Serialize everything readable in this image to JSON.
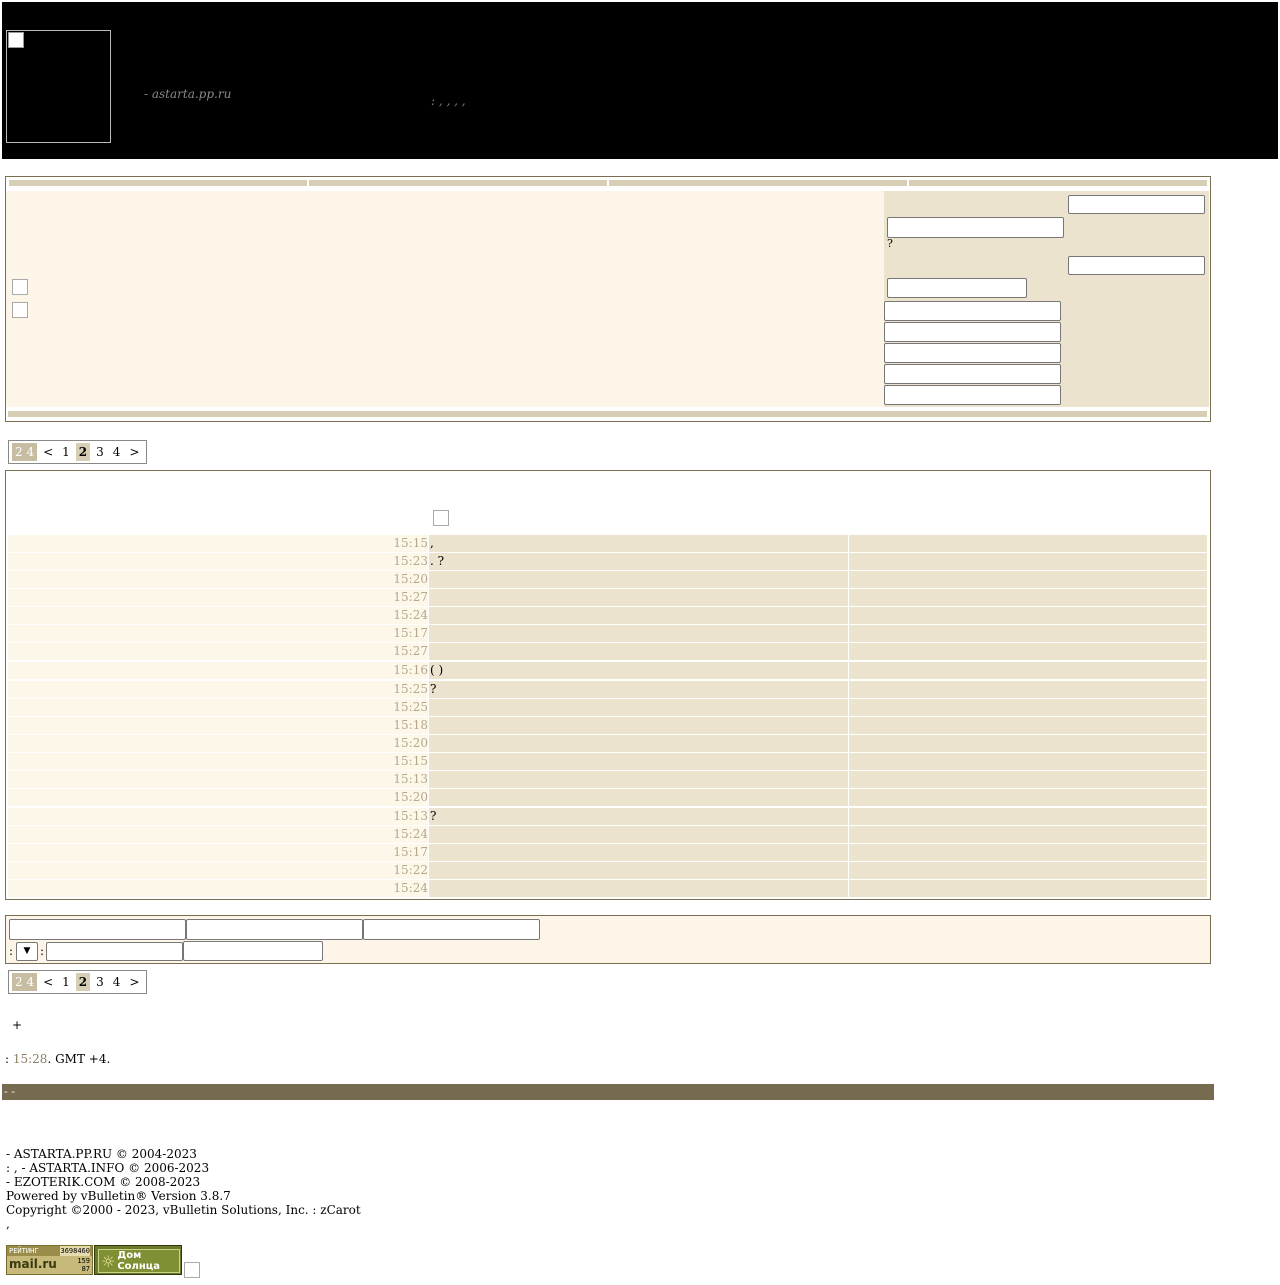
{
  "header": {
    "site_subtitle": "- astarta.pp.ru",
    "site_tags": ": , , , ,"
  },
  "pagination": {
    "info": "2 4",
    "prev": "<",
    "pages": [
      "1",
      "2",
      "3",
      "4"
    ],
    "current": "2",
    "next": ">"
  },
  "threads": [
    {
      "time": "15:15",
      "title": ","
    },
    {
      "time": "15:23",
      "title": ". ?"
    },
    {
      "time": "15:20",
      "title": ""
    },
    {
      "time": "15:27",
      "title": ""
    },
    {
      "time": "15:24",
      "title": ""
    },
    {
      "time": "15:17",
      "title": ""
    },
    {
      "time": "15:27",
      "title": ""
    },
    {
      "time": "15:16",
      "title": "( )"
    },
    {
      "time": "15:25",
      "title": "?"
    },
    {
      "time": "15:25",
      "title": ""
    },
    {
      "time": "15:18",
      "title": ""
    },
    {
      "time": "15:20",
      "title": ""
    },
    {
      "time": "15:15",
      "title": ""
    },
    {
      "time": "15:13",
      "title": ""
    },
    {
      "time": "15:20",
      "title": ""
    },
    {
      "time": "15:13",
      "title": "?"
    },
    {
      "time": "15:24",
      "title": ""
    },
    {
      "time": "15:17",
      "title": ""
    },
    {
      "time": "15:22",
      "title": ""
    },
    {
      "time": "15:24",
      "title": ""
    }
  ],
  "search": {
    "prefix": ":",
    "sep": ":"
  },
  "plus_sign": "+",
  "timezone": {
    "prefix": ": ",
    "time": "15:28",
    "suffix": ". GMT +4."
  },
  "brownbar_text": "- -",
  "footer": {
    "lines": [
      "- ASTARTA.PP.RU © 2004-2023",
      ": , - ASTARTA.INFO © 2006-2023",
      "- EZOTERIK.COM © 2008-2023",
      "Powered by vBulletin® Version 3.8.7",
      "Copyright ©2000 - 2023, vBulletin Solutions, Inc. : zCarot",
      ","
    ]
  },
  "counters": {
    "rating_label": "РЕЙТИНГ",
    "rating_number": "3698460",
    "mail_label": "mail.ru",
    "mail_n1": "159",
    "mail_n2": "87",
    "sun_label": "Дом Солнца"
  },
  "colors": {
    "accent_tan": "#d7ceb6",
    "cream": "#fdf6e8",
    "beige": "#ece3cf",
    "brown": "#766a50"
  }
}
